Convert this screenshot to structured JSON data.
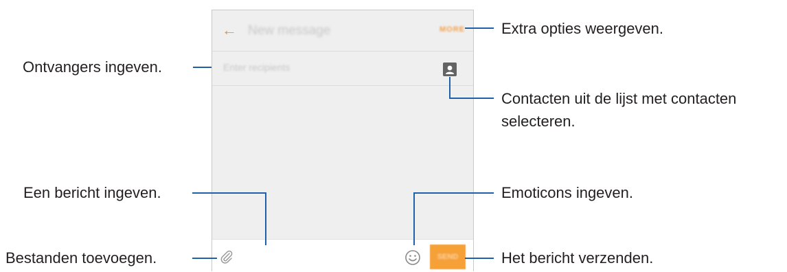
{
  "screen": {
    "title": "New message",
    "more_label": "MORE",
    "recipient_placeholder": "Enter recipients",
    "send_label": "SEND"
  },
  "icons": {
    "back": "back-arrow-icon",
    "contacts": "contact-card-icon",
    "attach": "paperclip-icon",
    "emoticon": "smiley-icon"
  },
  "colors": {
    "accent": "#f0922d",
    "callout_line": "#1f5fa8",
    "screen_bg": "#efefef"
  },
  "callouts": {
    "recipients": "Ontvangers ingeven.",
    "message": "Een bericht ingeven.",
    "attach": "Bestanden toevoegen.",
    "options": "Extra opties weergeven.",
    "contacts_line1": "Contacten uit de lijst met contacten",
    "contacts_line2": "selecteren.",
    "emoticons": "Emoticons ingeven.",
    "send": "Het bericht verzenden."
  }
}
